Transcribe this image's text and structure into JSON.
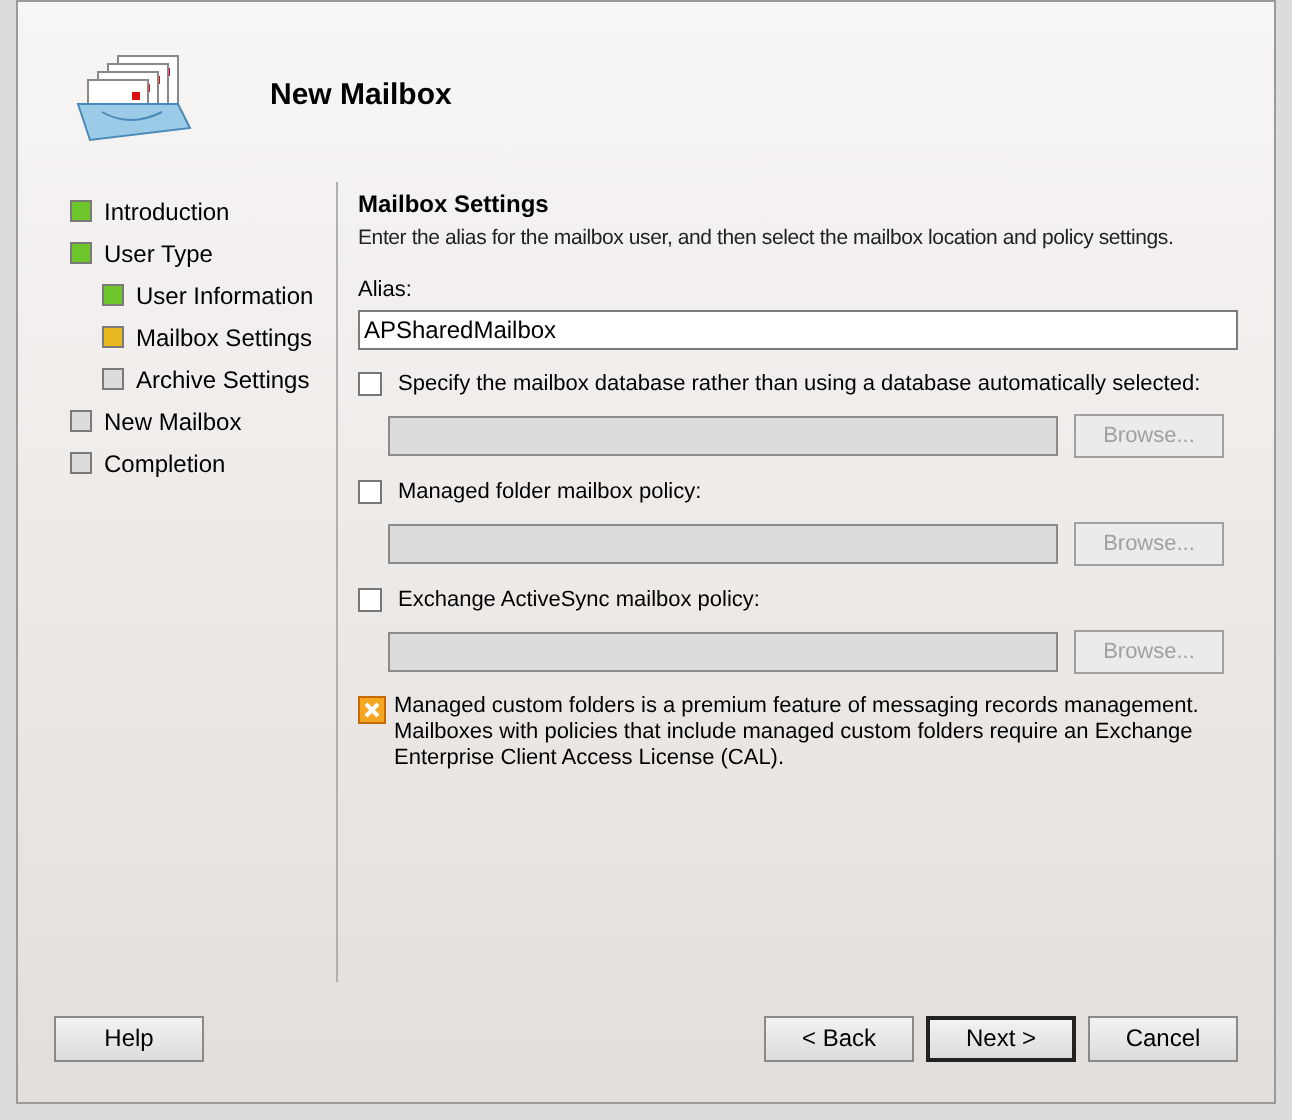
{
  "dialog": {
    "title": "New Mailbox"
  },
  "steps": [
    {
      "label": "Introduction",
      "color": "#6cc52a"
    },
    {
      "label": "User Type",
      "color": "#6cc52a",
      "children": [
        {
          "label": "User Information",
          "color": "#6cc52a"
        },
        {
          "label": "Mailbox Settings",
          "color": "#e8b820"
        },
        {
          "label": "Archive Settings",
          "color": "#dcdcdc"
        }
      ]
    },
    {
      "label": "New Mailbox",
      "color": "#dcdcdc"
    },
    {
      "label": "Completion",
      "color": "#dcdcdc"
    }
  ],
  "section": {
    "heading": "Mailbox Settings",
    "description": "Enter the alias for the mailbox user, and then select the mailbox location and policy settings."
  },
  "alias": {
    "label": "Alias:",
    "value": "APSharedMailbox"
  },
  "options": [
    {
      "label": "Specify the mailbox database rather than using a database automatically selected:",
      "checked": false,
      "button": "Browse...",
      "disabled": true
    },
    {
      "label": "Managed folder mailbox policy:",
      "checked": false,
      "button": "Browse...",
      "disabled": true
    },
    {
      "label": "Exchange ActiveSync mailbox policy:",
      "checked": false,
      "button": "Browse...",
      "disabled": true
    }
  ],
  "notice": "Managed custom folders is a premium feature of messaging records management. Mailboxes with policies that include managed custom folders require an Exchange Enterprise Client Access License (CAL).",
  "buttons": [
    {
      "label": "Help",
      "kind": "help",
      "default": false
    },
    {
      "label": "< Back",
      "kind": "nav",
      "default": false
    },
    {
      "label": "Next >",
      "kind": "nav",
      "default": true
    },
    {
      "label": "Cancel",
      "kind": "nav",
      "default": false
    }
  ]
}
